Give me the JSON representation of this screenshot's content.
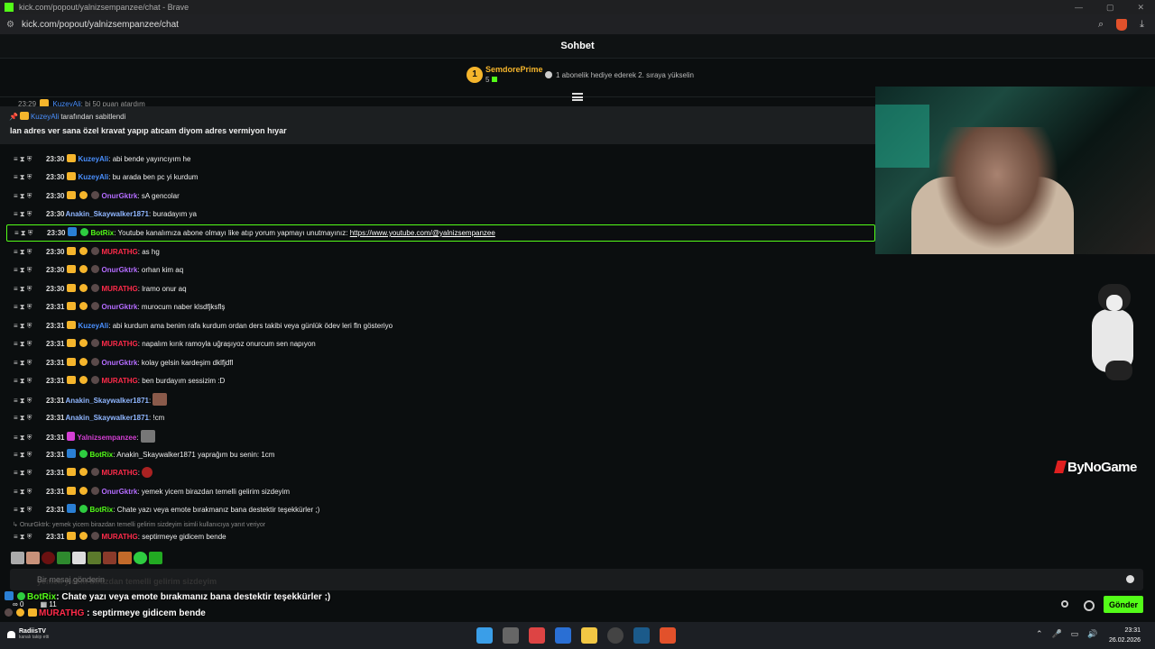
{
  "browser": {
    "title": "kick.com/popout/yalnizsempanzee/chat - Brave",
    "url": "kick.com/popout/yalnizsempanzee/chat",
    "window_controls": [
      "—",
      "▢",
      "✕"
    ]
  },
  "chat": {
    "header": "Sohbet",
    "gifter": {
      "rank": "1",
      "name": "SemdorePrime",
      "count": "5",
      "hint": "1 abonelik hediye ederek 2. sıraya yükselin"
    },
    "partial_message": {
      "time": "23:29",
      "user": "KuzeyAli",
      "text": ": bi 50 puan atardım"
    },
    "pinned": {
      "user": "KuzeyAli",
      "by_suffix": "tarafından sabitlendi",
      "message": "lan adres ver sana özel kravat yapıp atıcam diyom adres vermiyon hıyar"
    },
    "messages": [
      {
        "time": "23:30",
        "user": "KuzeyAli",
        "color": "#4a90ff",
        "badges": "crown",
        "text": ": abi bende yayıncıyım he"
      },
      {
        "time": "23:30",
        "user": "KuzeyAli",
        "color": "#4a90ff",
        "badges": "crown",
        "text": ": bu arada ben pc yi kurdum"
      },
      {
        "time": "23:30",
        "user": "OnurGktrk",
        "color": "#b46cff",
        "badges": "crown-sub-skull",
        "text": ": sA gencolar"
      },
      {
        "time": "23:30",
        "user": "Anakin_Skaywalker1871",
        "color": "#8fb6ff",
        "badges": "",
        "text": ": buradayım ya"
      },
      {
        "time": "23:30",
        "user": "BotRix",
        "color": "#53fc18",
        "badges": "bot",
        "text": ": Youtube kanalımıza abone olmayı like atıp yorum yapmayı unutmayınız: ",
        "link": "https://www.youtube.com/@yalnizsempanzee"
      },
      {
        "time": "23:30",
        "user": "MURATHG",
        "color": "#ff2b4a",
        "badges": "crown-sub-skull",
        "text": ": as hg"
      },
      {
        "time": "23:30",
        "user": "OnurGktrk",
        "color": "#b46cff",
        "badges": "crown-sub-skull",
        "text": ": orhan kim aq"
      },
      {
        "time": "23:30",
        "user": "MURATHG",
        "color": "#ff2b4a",
        "badges": "crown-sub-skull",
        "text": ": lramo onur aq"
      },
      {
        "time": "23:31",
        "user": "OnurGktrk",
        "color": "#b46cff",
        "badges": "crown-sub-skull",
        "text": ": murocum naber klsdfjksflş"
      },
      {
        "time": "23:31",
        "user": "KuzeyAli",
        "color": "#4a90ff",
        "badges": "crown",
        "text": ": abi kurdum ama benim rafa kurdum ordan ders takibi veya günlük ödev leri fln gösteriyo"
      },
      {
        "time": "23:31",
        "user": "MURATHG",
        "color": "#ff2b4a",
        "badges": "crown-sub-skull",
        "text": ": napalım kırık ramoyla uğraşıyoz onurcum sen napıyon"
      },
      {
        "time": "23:31",
        "user": "OnurGktrk",
        "color": "#b46cff",
        "badges": "crown-sub-skull",
        "text": ": kolay gelsin kardeşim dklfjdfl"
      },
      {
        "time": "23:31",
        "user": "MURATHG",
        "color": "#ff2b4a",
        "badges": "crown-sub-skull",
        "text": ": ben burdayım sessizim :D"
      },
      {
        "time": "23:31",
        "user": "Anakin_Skaywalker1871",
        "color": "#8fb6ff",
        "badges": "",
        "text": ":",
        "emote": "brown"
      },
      {
        "time": "23:31",
        "user": "Anakin_Skaywalker1871",
        "color": "#8fb6ff",
        "badges": "",
        "text": ": !cm"
      },
      {
        "time": "23:31",
        "user": "Yalnizsempanzee",
        "color": "#d43fd4",
        "badges": "pin",
        "text": ":",
        "emote": "gray"
      },
      {
        "time": "23:31",
        "user": "BotRix",
        "color": "#53fc18",
        "badges": "bot",
        "text": ": Anakin_Skaywalker1871 yaprağım bu senin: 1cm"
      },
      {
        "time": "23:31",
        "user": "MURATHG",
        "color": "#ff2b4a",
        "badges": "crown-sub-skull",
        "text": ":",
        "emote": "red"
      },
      {
        "time": "23:31",
        "user": "OnurGktrk",
        "color": "#b46cff",
        "badges": "crown-sub-skull",
        "text": ": yemek yicem birazdan temelli gelirim sizdeyim"
      },
      {
        "time": "23:31",
        "user": "BotRix",
        "color": "#53fc18",
        "badges": "bot",
        "text": ": Chate yazı veya emote bırakmanız bana destektir teşekkürler ;)"
      },
      {
        "time": "23:31",
        "user": "MURATHG",
        "color": "#ff2b4a",
        "badges": "crown-sub-skull",
        "text": ": septirmeye gidicem bende"
      }
    ],
    "reply_hint": "OnurGktrk: yemek yicem birazdan temelli gelirim sizdeyim isimli kullanıcıya yanıt veriyor",
    "input_placeholder": "Bir mesaj gönderin",
    "input_ghost": "yemek yicem birazdan temelli gelirim sizdeyim",
    "send_label": "Gönder"
  },
  "overlay": {
    "line1_user": "BotRix",
    "line1_text": ": Chate yazı veya emote bırakmanız bana destektir teşekkürler ;)",
    "line2_user": "MURATHG",
    "line2_text": ": septirmeye gidicem bende",
    "stats_a": "0",
    "stats_b": "11",
    "brand": "ByNoGame"
  },
  "taskbar": {
    "channel_name": "RadiisTV",
    "channel_sub": "kanalı takip etti",
    "time": "23:31",
    "date": "26.02.2026"
  },
  "colors": {
    "kick_green": "#53fc18",
    "gold": "#f5b52c"
  }
}
